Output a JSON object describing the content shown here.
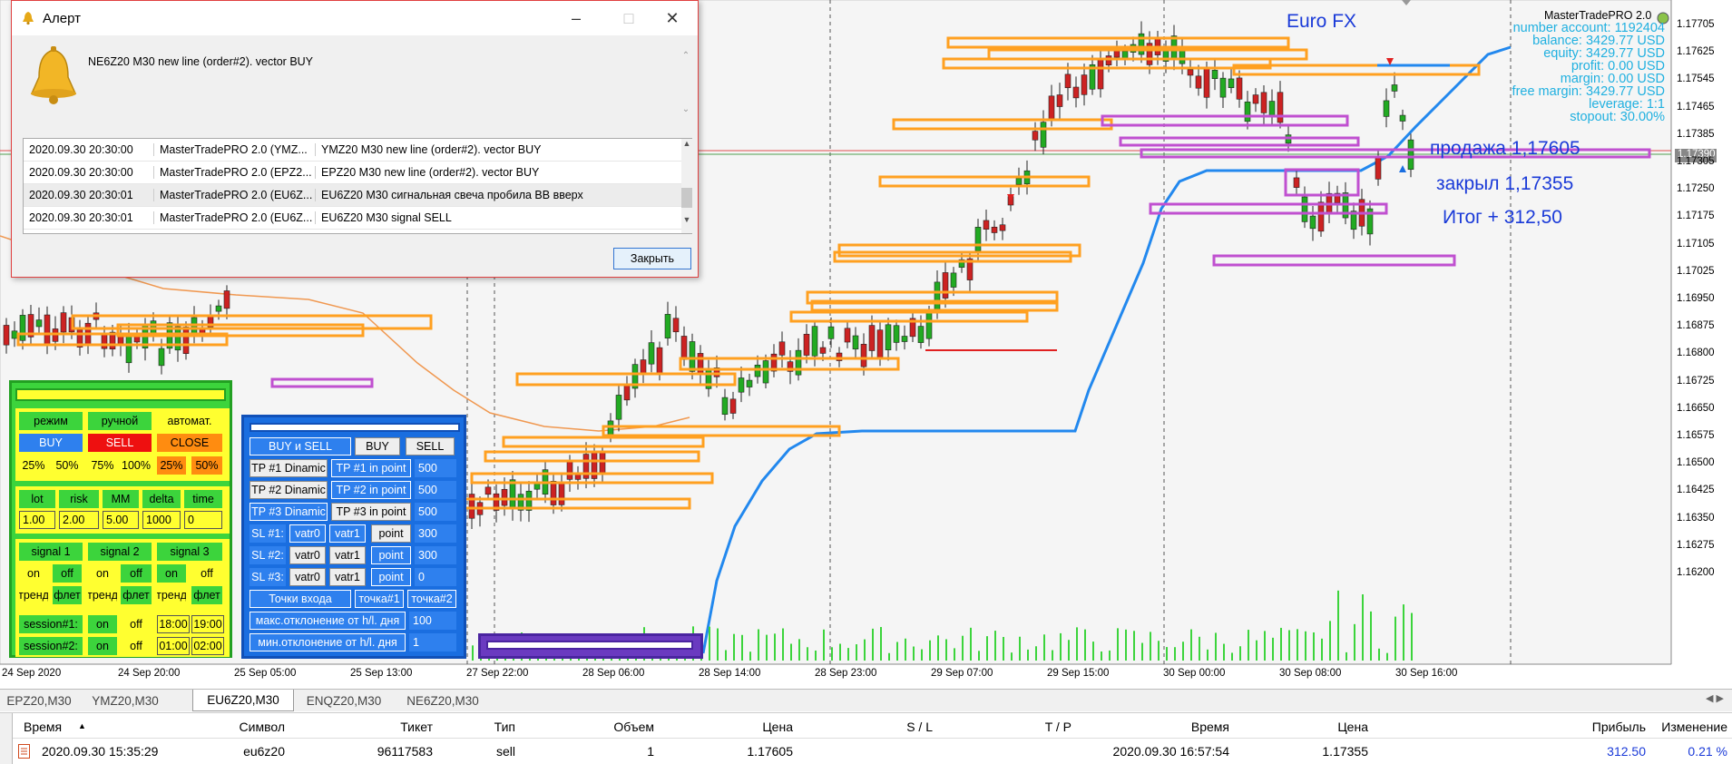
{
  "chart": {
    "symbol_title": "Euro FX",
    "brand": "MasterTradePRO 2.0",
    "account_info": [
      "number account: 1192404",
      "balance: 3429.77 USD",
      "equity: 3429.77 USD",
      "profit: 0.00 USD",
      "margin: 0.00 USD",
      "free margin: 3429.77 USD",
      "leverage: 1:1",
      "stopout: 30.00%"
    ],
    "annotations": [
      "продажа 1,17605",
      "закрыл 1,17355",
      "Итог + 312,50"
    ],
    "current_price": "1.17390",
    "price_axis": [
      "1.17705",
      "1.17625",
      "1.17545",
      "1.17465",
      "1.17385",
      "1.17305",
      "1.17250",
      "1.17175",
      "1.17105",
      "1.17025",
      "1.16950",
      "1.16875",
      "1.16800",
      "1.16725",
      "1.16650",
      "1.16575",
      "1.16500",
      "1.16425",
      "1.16350",
      "1.16275",
      "1.16200"
    ],
    "time_axis": [
      "24 Sep 2020",
      "24 Sep 20:00",
      "25 Sep 05:00",
      "25 Sep 13:00",
      "27 Sep 22:00",
      "28 Sep 06:00",
      "28 Sep 14:00",
      "28 Sep 23:00",
      "29 Sep 07:00",
      "29 Sep 15:00",
      "30 Sep 00:00",
      "30 Sep 08:00",
      "30 Sep 16:00"
    ],
    "colors": {
      "bull": "#22aa22",
      "bear": "#cc2222",
      "level_orange": "#ffa020",
      "level_purple": "#c050d0",
      "trend_blue": "#2288ee",
      "info_cyan": "#20b0e0"
    }
  },
  "alert": {
    "title": "Алерт",
    "message": "NE6Z20 M30 new line (order#2). vector BUY",
    "rows": [
      [
        "2020.09.30 20:30:00",
        "MasterTradePRO 2.0 (YMZ...",
        "YMZ20 M30 new line (order#2). vector BUY"
      ],
      [
        "2020.09.30 20:30:00",
        "MasterTradePRO 2.0 (EPZ2...",
        "EPZ20 M30 new line (order#2). vector BUY"
      ],
      [
        "2020.09.30 20:30:01",
        "MasterTradePRO 2.0 (EU6Z...",
        "EU6Z20 M30 сигнальная свеча пробила BB вверх"
      ],
      [
        "2020.09.30 20:30:01",
        "MasterTradePRO 2.0 (EU6Z...",
        "EU6Z20 M30 signal SELL"
      ]
    ],
    "close_label": "Закрыть"
  },
  "panel_left": {
    "mode": [
      "режим",
      "ручной",
      "автомат."
    ],
    "buy": "BUY",
    "sell": "SELL",
    "close": "CLOSE",
    "pcts_a": [
      "25%",
      "50%",
      "75%",
      "100%"
    ],
    "pcts_b": [
      "25%",
      "50%"
    ],
    "params_labels": [
      "lot",
      "risk",
      "MM",
      "delta",
      "time"
    ],
    "params_values": [
      "1.00",
      "2.00",
      "5.00",
      "1000",
      "0"
    ],
    "signals": [
      "signal 1",
      "signal 2",
      "signal 3"
    ],
    "on": "on",
    "off": "off",
    "trend": "тренд",
    "flat": "флет",
    "session1": "session#1:",
    "session2": "session#2:",
    "s1_times": [
      "18:00",
      "19:00"
    ],
    "s2_times": [
      "01:00",
      "02:00"
    ]
  },
  "panel_right": {
    "top": [
      "BUY и SELL",
      "BUY",
      "SELL"
    ],
    "tp_rows": [
      [
        "TP #1 Dinamic",
        "TP #1 in point",
        "500"
      ],
      [
        "TP #2 Dinamic",
        "TP #2 in point",
        "500"
      ],
      [
        "TP #3 Dinamic",
        "TP #3 in point",
        "500"
      ]
    ],
    "sl_rows": [
      [
        "SL #1:",
        "vatr0",
        "vatr1",
        "point",
        "300"
      ],
      [
        "SL #2:",
        "vatr0",
        "vatr1",
        "point",
        "300"
      ],
      [
        "SL #3:",
        "vatr0",
        "vatr1",
        "point",
        "0"
      ]
    ],
    "entry": [
      "Точки входа",
      "точка#1",
      "точка#2"
    ],
    "max_dev": [
      "макс.отклонение от h/l. дня",
      "100"
    ],
    "min_dev": [
      "мин.отклонение от h/l. дня",
      "1"
    ]
  },
  "tabs": [
    "EPZ20,M30",
    "YMZ20,M30",
    "EU6Z20,M30",
    "ENQZ20,M30",
    "NE6Z20,M30"
  ],
  "active_tab": 2,
  "trade_table": {
    "headers": [
      "Время",
      "Символ",
      "Тикет",
      "Тип",
      "Объем",
      "Цена",
      "S / L",
      "T / P",
      "Время",
      "Цена",
      "Прибыль",
      "Изменение"
    ],
    "row": [
      "2020.09.30 15:35:29",
      "eu6z20",
      "96117583",
      "sell",
      "1",
      "1.17605",
      "",
      "",
      "2020.09.30 16:57:54",
      "1.17355",
      "312.50",
      "0.21 %"
    ]
  }
}
